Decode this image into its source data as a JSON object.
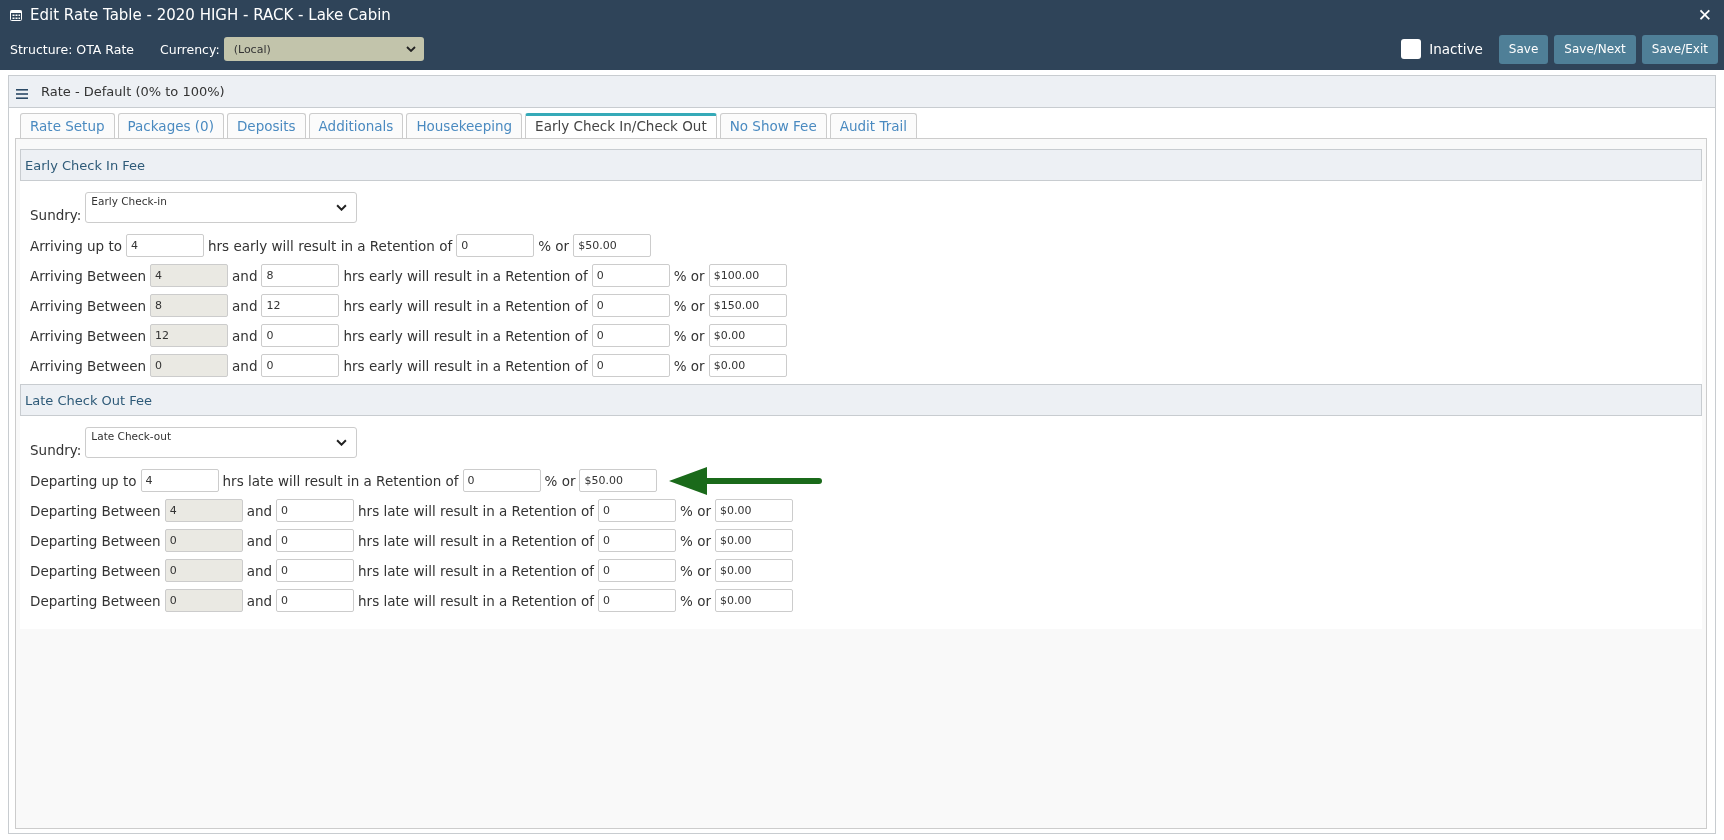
{
  "window": {
    "title": "Edit Rate Table - 2020 HIGH - RACK - Lake Cabin",
    "close": "✕"
  },
  "toolbar": {
    "structure": "Structure: OTA Rate",
    "currency_label": "Currency:",
    "currency_value": "(Local)",
    "inactive": {
      "label": "Inactive",
      "checked": false
    },
    "buttons": [
      "Save",
      "Save/Next",
      "Save/Exit"
    ]
  },
  "panel": {
    "title": "Rate - Default (0% to 100%)"
  },
  "tabs": [
    {
      "label": "Rate Setup",
      "selected": false
    },
    {
      "label": "Packages (0)",
      "selected": false
    },
    {
      "label": "Deposits",
      "selected": false
    },
    {
      "label": "Additionals",
      "selected": false
    },
    {
      "label": "Housekeeping",
      "selected": false
    },
    {
      "label": "Early Check In/Check Out",
      "selected": true
    },
    {
      "label": "No Show Fee",
      "selected": false
    },
    {
      "label": "Audit Trail",
      "selected": false
    }
  ],
  "sections": [
    {
      "title": "Early Check In Fee",
      "sundry_label": "Sundry:",
      "sundry_value": "Early Check-in",
      "arrow": false,
      "rows": [
        {
          "kind": "upto",
          "label": "Arriving up to",
          "to": "4",
          "phrase": "hrs early will result in a Retention of",
          "percent": "0",
          "or_text": "% or",
          "amount": "$50.00"
        },
        {
          "kind": "between",
          "label": "Arriving Between",
          "from": "4",
          "and_text": "and",
          "to": "8",
          "phrase": "hrs early will result in a Retention of",
          "percent": "0",
          "or_text": "% or",
          "amount": "$100.00"
        },
        {
          "kind": "between",
          "label": "Arriving Between",
          "from": "8",
          "and_text": "and",
          "to": "12",
          "phrase": "hrs early will result in a Retention of",
          "percent": "0",
          "or_text": "% or",
          "amount": "$150.00"
        },
        {
          "kind": "between",
          "label": "Arriving Between",
          "from": "12",
          "and_text": "and",
          "to": "0",
          "phrase": "hrs early will result in a Retention of",
          "percent": "0",
          "or_text": "% or",
          "amount": "$0.00"
        },
        {
          "kind": "between",
          "label": "Arriving Between",
          "from": "0",
          "and_text": "and",
          "to": "0",
          "phrase": "hrs early will result in a Retention of",
          "percent": "0",
          "or_text": "% or",
          "amount": "$0.00"
        }
      ]
    },
    {
      "title": "Late Check Out Fee",
      "sundry_label": "Sundry:",
      "sundry_value": "Late Check-out",
      "arrow": true,
      "rows": [
        {
          "kind": "upto",
          "label": "Departing up to",
          "to": "4",
          "phrase": "hrs late will result in a Retention of",
          "percent": "0",
          "or_text": "% or",
          "amount": "$50.00"
        },
        {
          "kind": "between",
          "label": "Departing Between",
          "from": "4",
          "and_text": "and",
          "to": "0",
          "phrase": "hrs late will result in a Retention of",
          "percent": "0",
          "or_text": "% or",
          "amount": "$0.00"
        },
        {
          "kind": "between",
          "label": "Departing Between",
          "from": "0",
          "and_text": "and",
          "to": "0",
          "phrase": "hrs late will result in a Retention of",
          "percent": "0",
          "or_text": "% or",
          "amount": "$0.00"
        },
        {
          "kind": "between",
          "label": "Departing Between",
          "from": "0",
          "and_text": "and",
          "to": "0",
          "phrase": "hrs late will result in a Retention of",
          "percent": "0",
          "or_text": "% or",
          "amount": "$0.00"
        },
        {
          "kind": "between",
          "label": "Departing Between",
          "from": "0",
          "and_text": "and",
          "to": "0",
          "phrase": "hrs late will result in a Retention of",
          "percent": "0",
          "or_text": "% or",
          "amount": "$0.00"
        }
      ]
    }
  ]
}
